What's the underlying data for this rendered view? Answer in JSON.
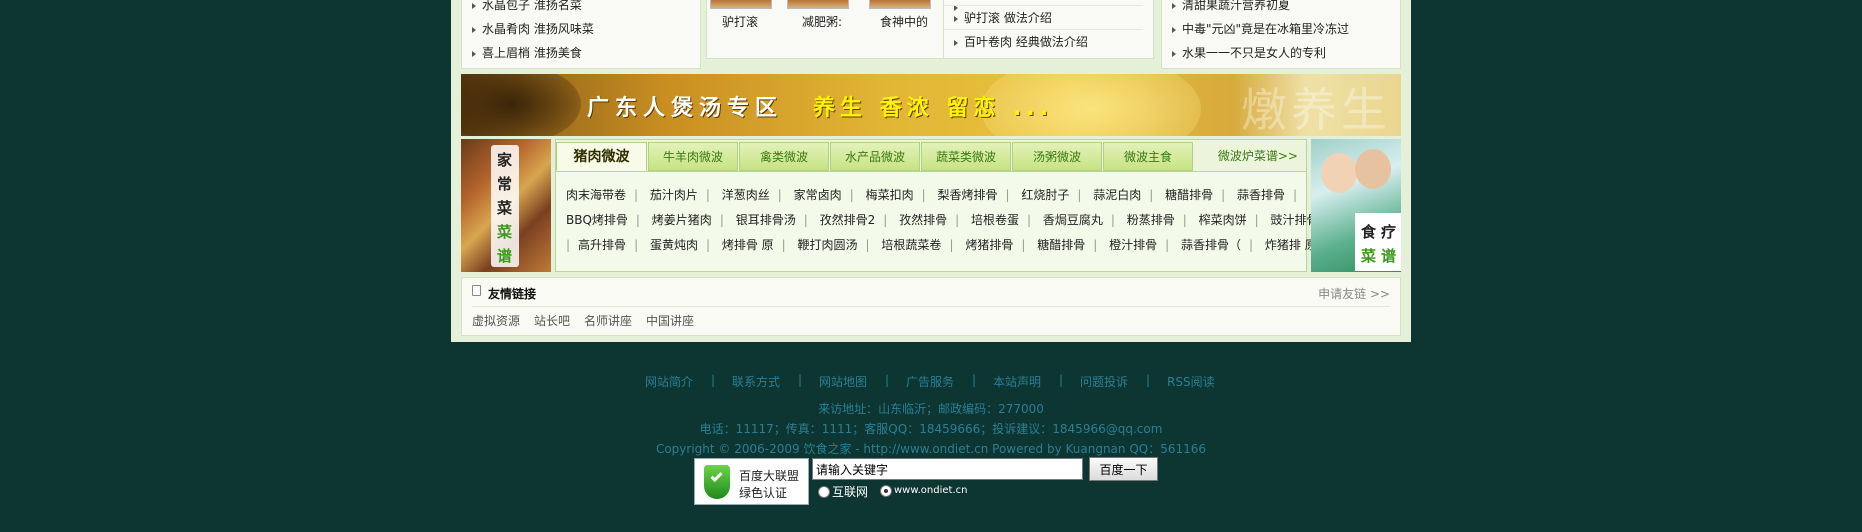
{
  "left_list": [
    "水晶包子 淮扬名菜",
    "水晶肴肉 淮扬风味菜",
    "喜上眉梢 淮扬美食"
  ],
  "thumbs": [
    "驴打滚",
    "减肥粥:",
    "食神中的"
  ],
  "green_list": [
    "驴打滚 做法介绍",
    "百叶卷肉 经典做法介绍"
  ],
  "right_list": [
    "清甜果蔬汁营养初夏",
    "中毒\"元凶\"竟是在冰箱里冷冻过",
    "水果一一不只是女人的专利"
  ],
  "banner": {
    "text1": "广东人煲汤专区",
    "text2": "养生 香浓 留恋 ...",
    "deco": "燉养生"
  },
  "left_ad": {
    "chars": [
      "家",
      "常",
      "菜",
      "菜",
      "谱"
    ]
  },
  "right_ad": {
    "chars": [
      "食",
      "疗",
      "菜",
      "谱"
    ]
  },
  "tabs": [
    "猪肉微波",
    "牛羊肉微波",
    "禽类微波",
    "水产品微波",
    "蔬菜类微波",
    "汤粥微波",
    "微波主食"
  ],
  "tab_more": "微波炉菜谱>>",
  "recipes": [
    [
      "肉末海带卷",
      "茄汁肉片",
      "洋葱肉丝",
      "家常卤肉",
      "梅菜扣肉",
      "梨香烤排骨",
      "红烧肘子",
      "蒜泥白肉",
      "糖醋排骨",
      "蒜香排骨"
    ],
    [
      "BBQ烤排骨",
      "烤姜片猪肉",
      "银耳排骨汤",
      "孜然排骨2",
      "孜然排骨",
      "培根卷蛋",
      "香焗豆腐丸",
      "粉蒸排骨",
      "榨菜肉饼",
      "豉汁排骨"
    ],
    [
      "高升排骨",
      "蛋黄炖肉",
      "烤排骨 原",
      "鞭打肉圆汤",
      "培根蔬菜卷",
      "烤猪排骨",
      "糖醋排骨",
      "橙汁排骨",
      "蒜香排骨（",
      "炸猪排 原"
    ]
  ],
  "links": {
    "title": "友情链接",
    "apply": "申请友链 >>",
    "items": [
      "虚拟资源",
      "站长吧",
      "名师讲座",
      "中国讲座"
    ]
  },
  "footer": {
    "nav": [
      "网站简介",
      "联系方式",
      "网站地图",
      "广告服务",
      "本站声明",
      "问题投诉",
      "RSS阅读"
    ],
    "separator": "|",
    "address": "来访地址：山东临沂；邮政编码：277000",
    "contact": "电话：11117；传真：1111；客服QQ：18459666；投诉建议：1845966@qq.com",
    "copyright": "Copyright © 2006-2009 饮食之家 - http://www.ondiet.cn Powered by  Kuangnan  QQ：561166"
  },
  "badge": {
    "line1": "百度大联盟",
    "line2": "绿色认证"
  },
  "search": {
    "value": "请输入关键字",
    "button": "百度一下",
    "opt1": "互联网",
    "opt2": "www.ondiet.cn"
  }
}
